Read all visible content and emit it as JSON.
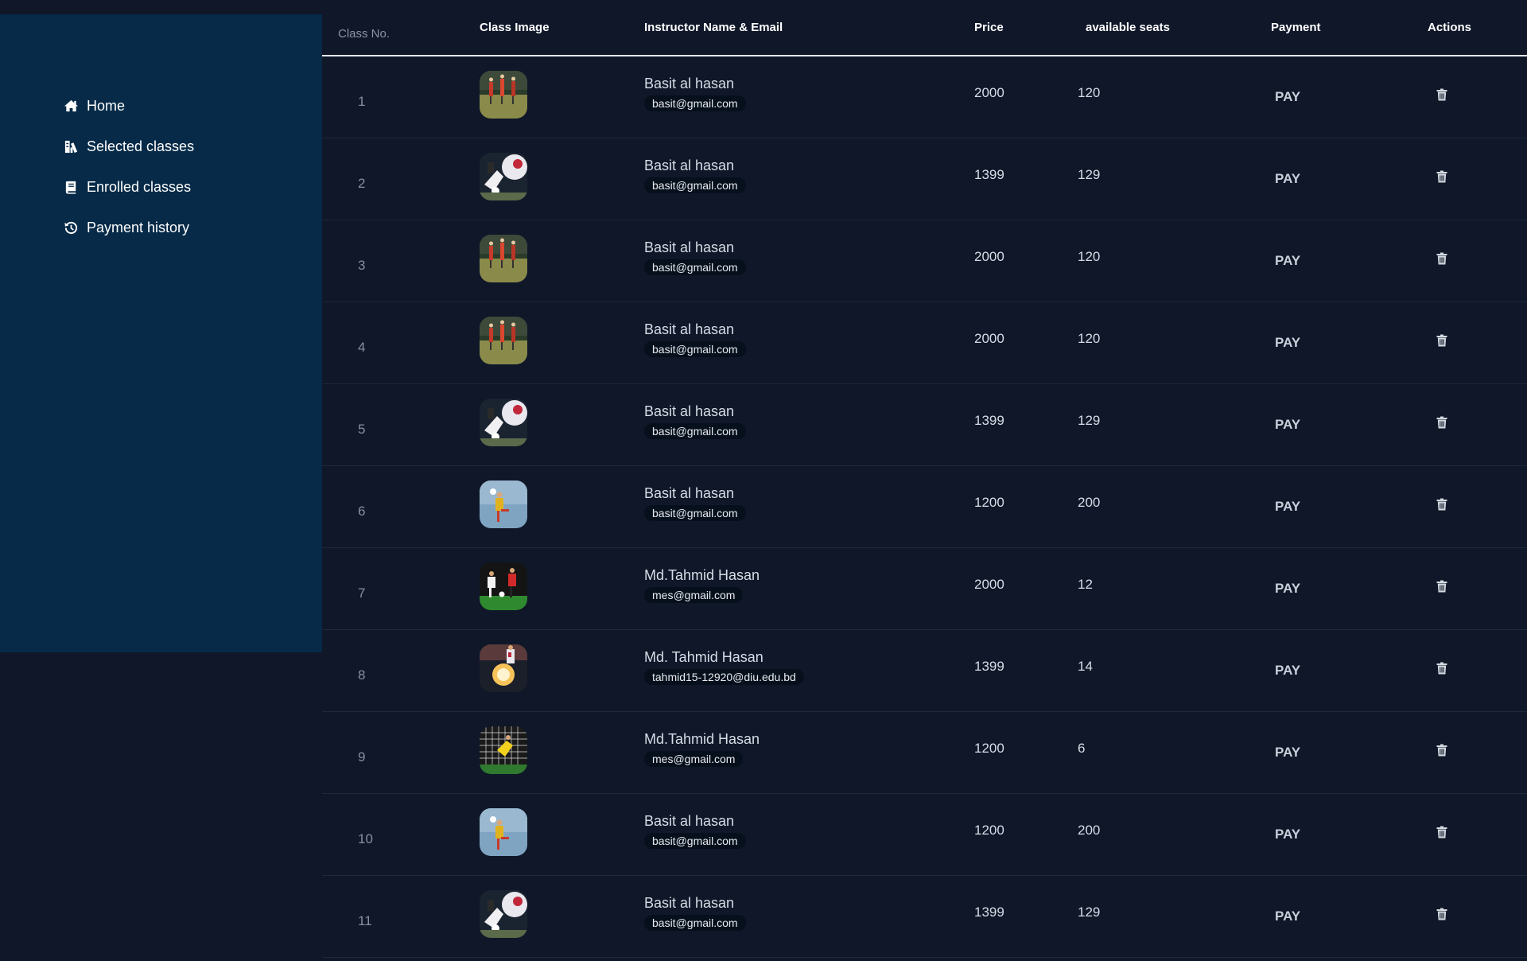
{
  "sidebar": {
    "items": [
      {
        "label": "Home",
        "icon": "home-icon"
      },
      {
        "label": "Selected classes",
        "icon": "selected-classes-icon"
      },
      {
        "label": "Enrolled classes",
        "icon": "book-icon"
      },
      {
        "label": "Payment history",
        "icon": "history-icon"
      }
    ]
  },
  "table": {
    "headers": {
      "class_no": "Class No.",
      "class_image": "Class Image",
      "instructor": "Instructor Name & Email",
      "price": "Price",
      "seats": "available seats",
      "payment": "Payment",
      "actions": "Actions"
    },
    "pay_label": "PAY",
    "rows": [
      {
        "no": "1",
        "image": "team-training",
        "name": "Basit al hasan",
        "email": "basit@gmail.com",
        "price": "2000",
        "seats": "120"
      },
      {
        "no": "2",
        "image": "kick-action",
        "name": "Basit al hasan",
        "email": "basit@gmail.com",
        "price": "1399",
        "seats": "129"
      },
      {
        "no": "3",
        "image": "team-training",
        "name": "Basit al hasan",
        "email": "basit@gmail.com",
        "price": "2000",
        "seats": "120"
      },
      {
        "no": "4",
        "image": "team-training",
        "name": "Basit al hasan",
        "email": "basit@gmail.com",
        "price": "2000",
        "seats": "120"
      },
      {
        "no": "5",
        "image": "kick-action",
        "name": "Basit al hasan",
        "email": "basit@gmail.com",
        "price": "1399",
        "seats": "129"
      },
      {
        "no": "6",
        "image": "player-sky",
        "name": "Basit al hasan",
        "email": "basit@gmail.com",
        "price": "1200",
        "seats": "200"
      },
      {
        "no": "7",
        "image": "two-players",
        "name": "Md.Tahmid Hasan",
        "email": "mes@gmail.com",
        "price": "2000",
        "seats": "12"
      },
      {
        "no": "8",
        "image": "ball-fire",
        "name": "Md. Tahmid Hasan",
        "email": "tahmid15-12920@diu.edu.bd",
        "price": "1399",
        "seats": "14"
      },
      {
        "no": "9",
        "image": "goalkeeper",
        "name": "Md.Tahmid Hasan",
        "email": "mes@gmail.com",
        "price": "1200",
        "seats": "6"
      },
      {
        "no": "10",
        "image": "player-sky",
        "name": "Basit al hasan",
        "email": "basit@gmail.com",
        "price": "1200",
        "seats": "200"
      },
      {
        "no": "11",
        "image": "kick-action",
        "name": "Basit al hasan",
        "email": "basit@gmail.com",
        "price": "1399",
        "seats": "129"
      }
    ]
  },
  "colors": {
    "background": "#0f1729",
    "sidebar": "#062a47",
    "email_badge": "#06101c",
    "header_rule": "#e5e7eb"
  }
}
